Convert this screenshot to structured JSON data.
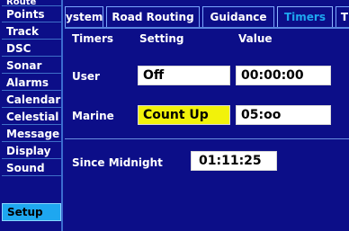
{
  "sidebar": {
    "items": [
      {
        "label": "Route"
      },
      {
        "label": "Points"
      },
      {
        "label": "Track"
      },
      {
        "label": "DSC"
      },
      {
        "label": "Sonar"
      },
      {
        "label": "Alarms"
      },
      {
        "label": "Calendar"
      },
      {
        "label": "Celestial"
      },
      {
        "label": "Message"
      },
      {
        "label": "Display"
      },
      {
        "label": "Sound"
      },
      {
        "label": "Setup"
      }
    ],
    "active": "Setup"
  },
  "tabs": [
    {
      "label": "ystem"
    },
    {
      "label": "Road Routing"
    },
    {
      "label": "Guidance"
    },
    {
      "label": "Timers"
    },
    {
      "label": "T"
    }
  ],
  "active_tab": "Timers",
  "table": {
    "headers": [
      "Timers",
      "Setting",
      "Value"
    ],
    "rows": [
      {
        "name": "User",
        "setting": "Off",
        "value": "00:00:00"
      },
      {
        "name": "Marine",
        "setting": "Count Up",
        "value": "05:oo"
      }
    ]
  },
  "since_midnight": {
    "label": "Since Midnight",
    "value": "01:11:25"
  },
  "colors": {
    "background": "#0c0e88",
    "active_tab_text": "#1ea7f0",
    "active_sidebar": "#1ea7f0",
    "highlight_field": "#f2f20a"
  }
}
